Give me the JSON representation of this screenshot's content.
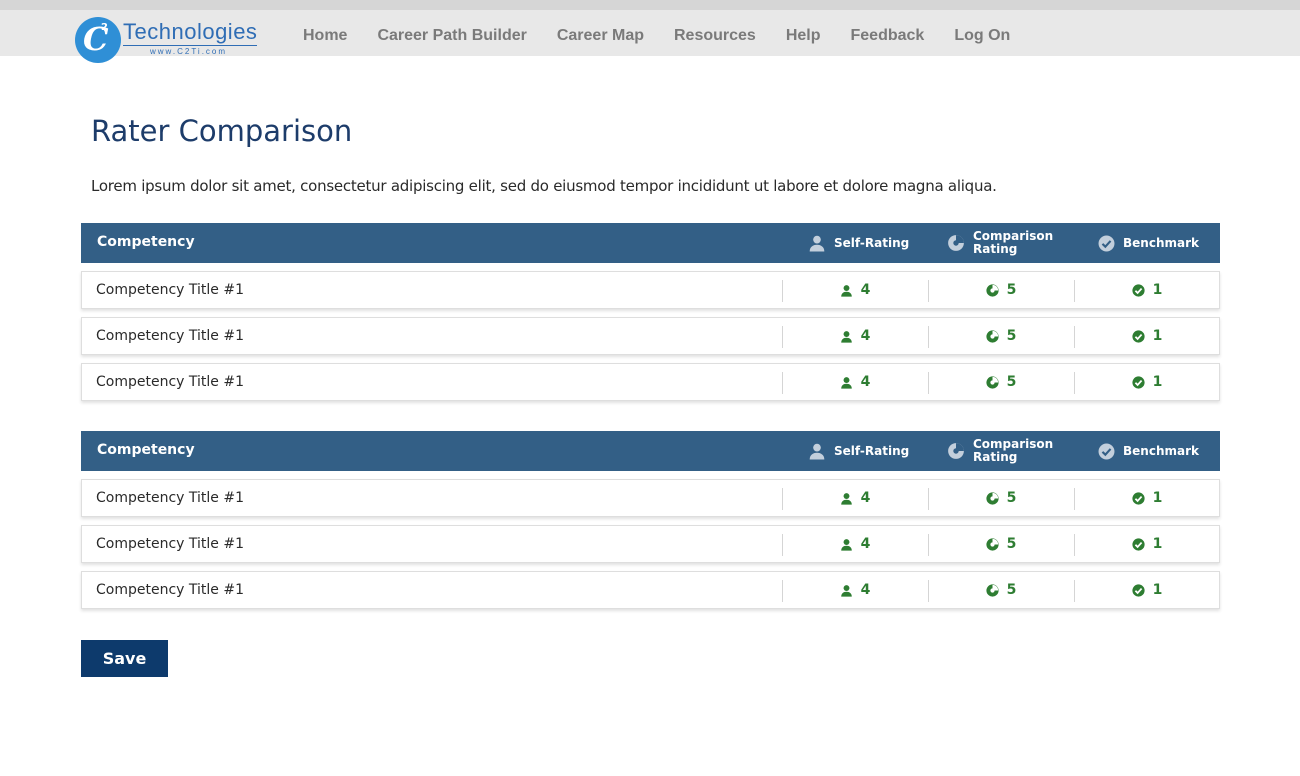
{
  "brand": {
    "logo_text": "Technologies",
    "logo_url": "www.C2Ti.com",
    "logo_sup": "2",
    "logo_letter": "C"
  },
  "nav": [
    "Home",
    "Career Path Builder",
    "Career Map",
    "Resources",
    "Help",
    "Feedback",
    "Log On"
  ],
  "page": {
    "title": "Rater Comparison",
    "description": "Lorem ipsum dolor sit amet, consectetur adipiscing elit, sed do eiusmod tempor incididunt ut labore et dolore magna aliqua."
  },
  "table_headers": {
    "competency": "Competency",
    "self_rating": "Self-Rating",
    "comparison_line1": "Comparison",
    "comparison_line2": "Rating",
    "benchmark": "Benchmark"
  },
  "tables": [
    {
      "rows": [
        {
          "title": "Competency Title #1",
          "self": "4",
          "comparison": "5",
          "benchmark": "1"
        },
        {
          "title": "Competency Title #1",
          "self": "4",
          "comparison": "5",
          "benchmark": "1"
        },
        {
          "title": "Competency Title #1",
          "self": "4",
          "comparison": "5",
          "benchmark": "1"
        }
      ]
    },
    {
      "rows": [
        {
          "title": "Competency Title #1",
          "self": "4",
          "comparison": "5",
          "benchmark": "1"
        },
        {
          "title": "Competency Title #1",
          "self": "4",
          "comparison": "5",
          "benchmark": "1"
        },
        {
          "title": "Competency Title #1",
          "self": "4",
          "comparison": "5",
          "benchmark": "1"
        }
      ]
    }
  ],
  "icons": {
    "self": "person-icon",
    "comparison": "pie-icon",
    "benchmark": "check-circle-icon"
  },
  "colors": {
    "header_bg": "#335f86",
    "accent_green": "#2e7d32",
    "title": "#1d3c6a",
    "save_bg": "#0d3a6c"
  },
  "save_label": "Save"
}
